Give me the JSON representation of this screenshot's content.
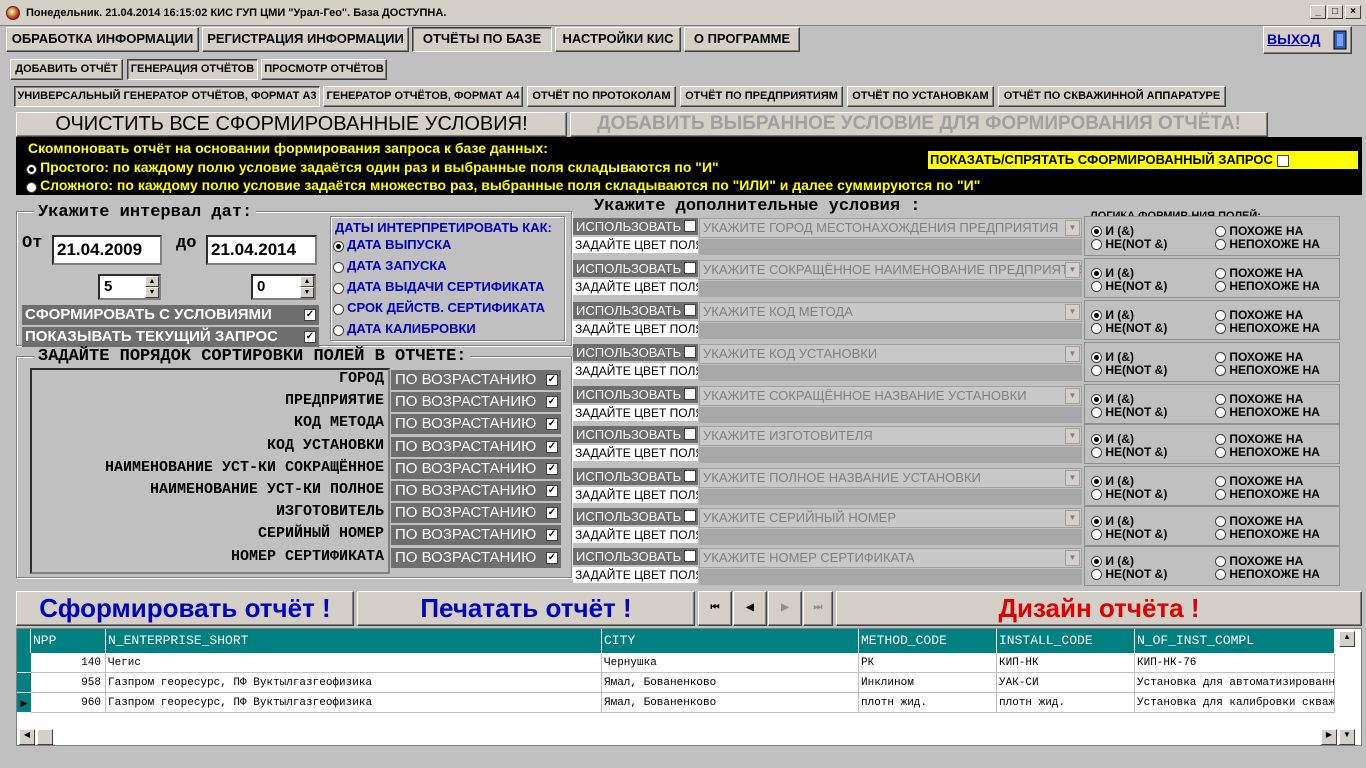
{
  "window": {
    "title": "Понедельник. 21.04.2014 16:15:02  КИС ГУП ЦМИ \"Урал-Гео\". База ДОСТУПНА.",
    "min": "_",
    "max": "□",
    "close": "×"
  },
  "menu": {
    "items": [
      "ОБРАБОТКА ИНФОРМАЦИИ",
      "РЕГИСТРАЦИЯ ИНФОРМАЦИИ",
      "ОТЧЁТЫ ПО БАЗЕ",
      "НАСТРОЙКИ КИС",
      "О ПРОГРАММЕ"
    ],
    "exit": "ВЫХОД"
  },
  "subtabs": [
    "ДОБАВИТЬ ОТЧЁТ",
    "ГЕНЕРАЦИЯ ОТЧЁТОВ",
    "ПРОСМОТР ОТЧЁТОВ"
  ],
  "reporttabs": [
    "УНИВЕРСАЛЬНЫЙ ГЕНЕРАТОР ОТЧЁТОВ, ФОРМАТ А3",
    "ГЕНЕРАТОР ОТЧЁТОВ, ФОРМАТ А4",
    "ОТЧЁТ ПО ПРОТОКОЛАМ",
    "ОТЧЁТ ПО ПРЕДПРИЯТИЯМ",
    "ОТЧЁТ ПО УСТАНОВКАМ",
    "ОТЧЁТ ПО СКВАЖИННОЙ АППАРАТУРЕ"
  ],
  "actions": {
    "clear": "ОЧИСТИТЬ ВСЕ СФОРМИРОВАННЫЕ УСЛОВИЯ!",
    "add": "ДОБАВИТЬ ВЫБРАННОЕ УСЛОВИЕ ДЛЯ ФОРМИРОВАНИЯ  ОТЧЁТА!"
  },
  "compose": {
    "heading": "Скомпоновать отчёт на основании формирования запроса к базе данных:",
    "simple": "Простого: по каждому полю условие задаётся один раз и выбранные поля складываются по \"И\"",
    "complex": "Сложного: по каждому полю условие задаётся множество раз, выбранные поля складываются по \"ИЛИ\" и далее суммируются по \"И\"",
    "toggle": "ПОКАЗАТЬ/СПРЯТАТЬ СФОРМИРОВАННЫЙ ЗАПРОС"
  },
  "dates": {
    "legend": "Укажите интервал дат:",
    "from_label": "От",
    "from": "21.04.2009",
    "to_label": "до",
    "to": "21.04.2014",
    "spin1": "5",
    "spin2": "0",
    "with_conditions": "СФОРМИРОВАТЬ С УСЛОВИЯМИ",
    "show_query": "ПОКАЗЫВАТЬ ТЕКУЩИЙ ЗАПРОС"
  },
  "interpret": {
    "title": "ДАТЫ ИНТЕРПРЕТИРОВАТЬ КАК:",
    "options": [
      "ДАТА ВЫПУСКА",
      "ДАТА ЗАПУСКА",
      "ДАТА ВЫДАЧИ  СЕРТИФИКАТА",
      "СРОК ДЕЙСТВ. СЕРТИФИКАТА",
      "ДАТА КАЛИБРОВКИ"
    ]
  },
  "sort": {
    "legend": "ЗАДАЙТЕ ПОРЯДОК СОРТИРОВКИ ПОЛЕЙ В ОТЧЕТЕ:",
    "order_label": "ПО ВОЗРАСТАНИЮ",
    "fields": [
      "ГОРОД",
      "ПРЕДПРИЯТИЕ",
      "КОД МЕТОДА",
      "КОД УСТАНОВКИ",
      "НАИМЕНОВАНИЕ УСТ-КИ СОКРАЩЁННОЕ",
      "НАИМЕНОВАНИЕ УСТ-КИ ПОЛНОЕ",
      "ИЗГОТОВИТЕЛЬ",
      "СЕРИЙНЫЙ НОМЕР",
      "НОМЕР СЕРТИФИКАТА"
    ]
  },
  "conditions": {
    "legend": "Укажите дополнительные условия :",
    "use_label": "ИСПОЛЬЗОВАТЬ",
    "color_label": "ЗАДАЙТЕ ЦВЕТ ПОЛЯ",
    "logic_title": "ЛОГИКА ФОРМИР-НИЯ ПОЛЕЙ:",
    "and": "И    (&)",
    "not": "НЕ(NOT &)",
    "like": "ПОХОЖЕ НА",
    "unlike": "НЕПОХОЖЕ НА",
    "placeholders": [
      "УКАЖИТЕ ГОРОД МЕСТОНАХОЖДЕНИЯ ПРЕДПРИЯТИЯ",
      "УКАЖИТЕ СОКРАЩЁННОЕ НАИМЕНОВАНИЕ ПРЕДПРИЯТИЯ",
      "УКАЖИТЕ КОД МЕТОДА",
      "УКАЖИТЕ КОД УСТАНОВКИ",
      "УКАЖИТЕ СОКРАЩЁННОЕ НАЗВАНИЕ УСТАНОВКИ",
      "УКАЖИТЕ ИЗГОТОВИТЕЛЯ",
      "УКАЖИТЕ ПОЛНОЕ НАЗВАНИЕ УСТАНОВКИ",
      "УКАЖИТЕ СЕРИЙНЫЙ НОМЕР",
      "УКАЖИТЕ НОМЕР СЕРТИФИКАТА"
    ]
  },
  "bottom": {
    "form": "Сформировать отчёт !",
    "print": "Печатать отчёт !",
    "design": "Дизайн отчёта !",
    "nav": [
      "⏮",
      "◀",
      "▶",
      "⏭"
    ]
  },
  "grid": {
    "columns": [
      "NPP",
      "N_ENTERPRISE_SHORT",
      "CITY",
      "METHOD_CODE",
      "INSTALL_CODE",
      "N_OF_INST_COMPL"
    ],
    "rows": [
      [
        "140",
        "Чегис",
        "Чернушка",
        "РК",
        "КИП-НК",
        "КИП-НК-76"
      ],
      [
        "958",
        "Газпром георесурс, ПФ Вуктылгазгеофизика",
        "Ямал, Бованенково",
        "Инклином",
        "УАК-СИ",
        "Установка для автоматизированной"
      ],
      [
        "960",
        "Газпром георесурс, ПФ Вуктылгазгеофизика",
        "Ямал, Бованенково",
        "плотн жид.",
        "плотн жид.",
        "Установка для калибровки скважинных"
      ]
    ]
  },
  "colors": {
    "teal": "#008080",
    "yellow": "#ffff00",
    "blue": "#0000c0",
    "red": "#e00000"
  }
}
